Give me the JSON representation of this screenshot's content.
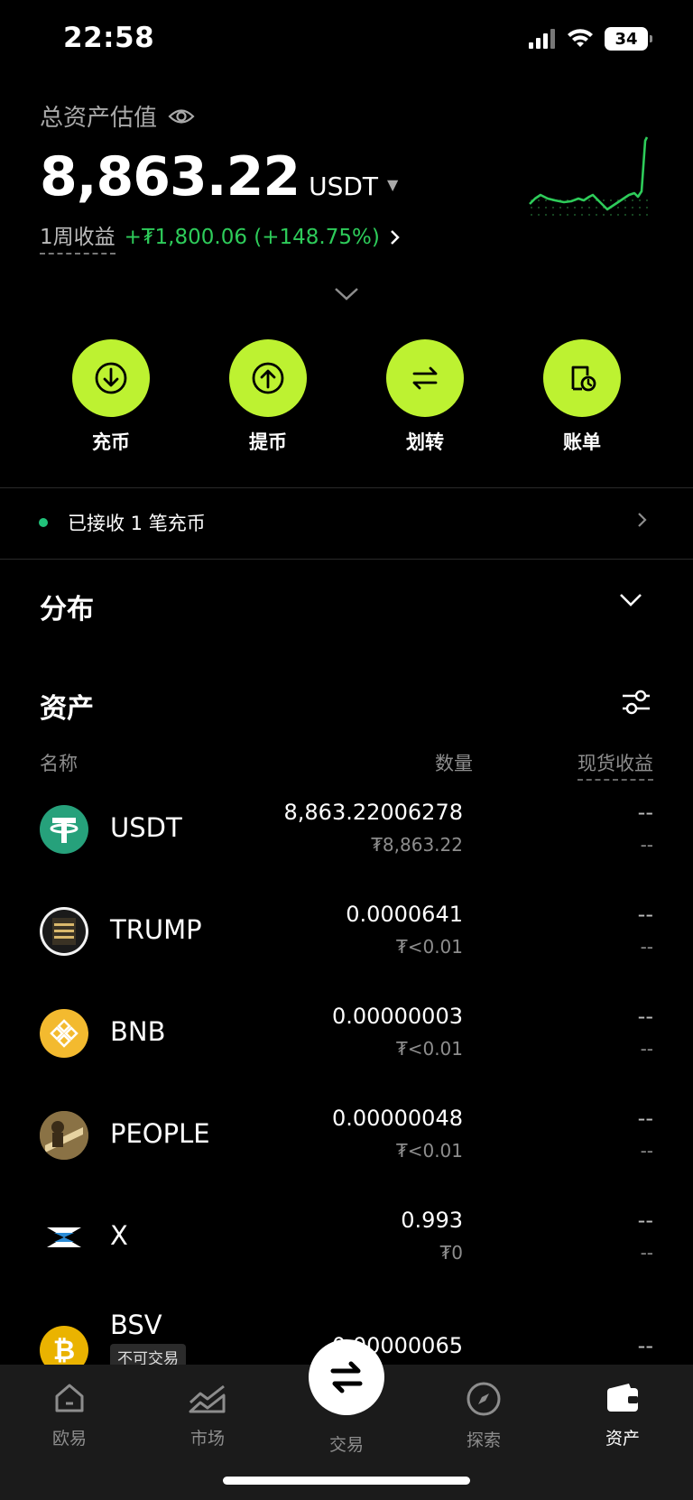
{
  "status": {
    "time": "22:58",
    "battery": "34"
  },
  "header": {
    "total_label": "总资产估值",
    "total_value": "8,863.22",
    "unit": "USDT",
    "week_label": "1周收益",
    "week_value": "+₮1,800.06 (+148.75%)"
  },
  "colors": {
    "accent": "#bdf231",
    "positive": "#2ecc5a",
    "notice_dot": "#21c27a"
  },
  "actions": [
    {
      "label": "充币",
      "icon": "deposit-icon"
    },
    {
      "label": "提币",
      "icon": "withdraw-icon"
    },
    {
      "label": "划转",
      "icon": "transfer-icon"
    },
    {
      "label": "账单",
      "icon": "bill-icon"
    }
  ],
  "notice": {
    "text": "已接收 1 笔充币"
  },
  "distribution": {
    "title": "分布"
  },
  "assets_section": {
    "title": "资产",
    "col_name": "名称",
    "col_qty": "数量",
    "col_pnl": "现货收益"
  },
  "assets": [
    {
      "symbol": "USDT",
      "qty": "8,863.22006278",
      "fiat": "₮8,863.22",
      "pnl": "--",
      "pnl_sub": "--"
    },
    {
      "symbol": "TRUMP",
      "qty": "0.0000641",
      "fiat": "₮<0.01",
      "pnl": "--",
      "pnl_sub": "--"
    },
    {
      "symbol": "BNB",
      "qty": "0.00000003",
      "fiat": "₮<0.01",
      "pnl": "--",
      "pnl_sub": "--"
    },
    {
      "symbol": "PEOPLE",
      "qty": "0.00000048",
      "fiat": "₮<0.01",
      "pnl": "--",
      "pnl_sub": "--"
    },
    {
      "symbol": "X",
      "qty": "0.993",
      "fiat": "₮0",
      "pnl": "--",
      "pnl_sub": "--"
    },
    {
      "symbol": "BSV",
      "qty": "0.00000065",
      "fiat": "",
      "pnl": "--",
      "pnl_sub": "",
      "badge": "不可交易"
    }
  ],
  "nav": [
    {
      "label": "欧易",
      "icon": "home-icon"
    },
    {
      "label": "市场",
      "icon": "market-icon"
    },
    {
      "label": "交易",
      "icon": "trade-swap-icon"
    },
    {
      "label": "探索",
      "icon": "compass-icon"
    },
    {
      "label": "资产",
      "icon": "wallet-icon"
    }
  ]
}
